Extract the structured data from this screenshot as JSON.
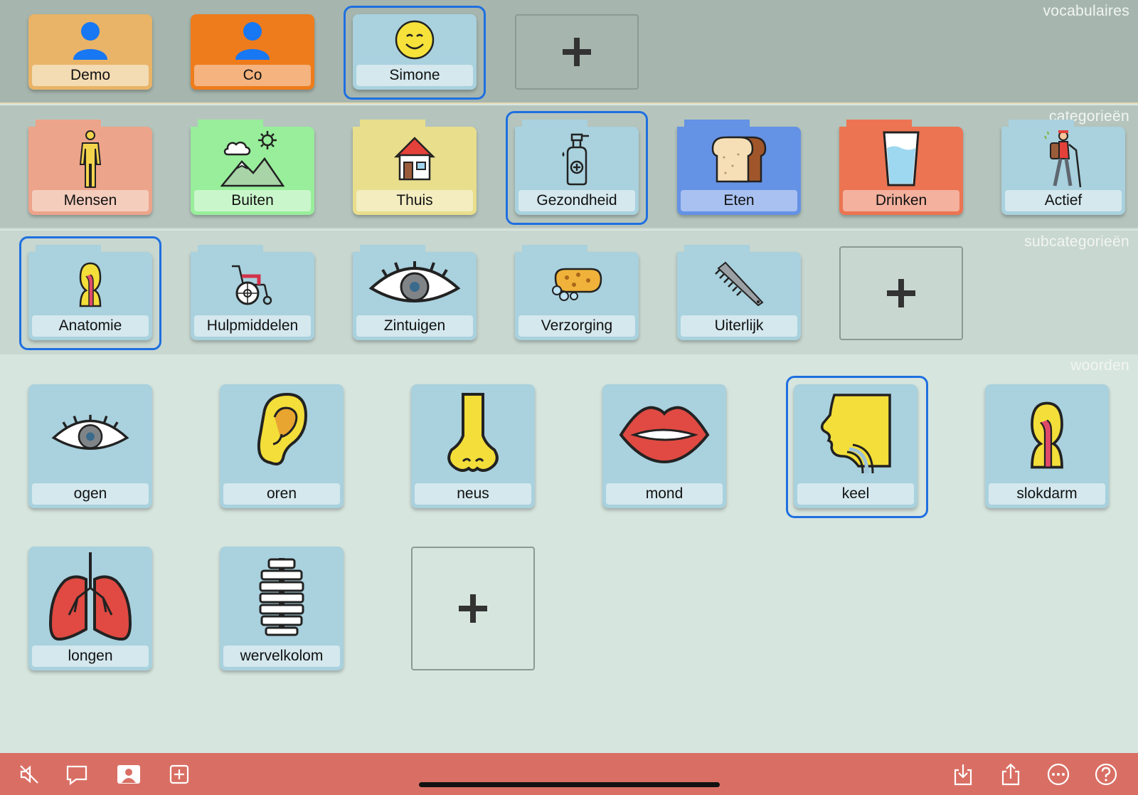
{
  "sections": {
    "vocabularies": "vocabulaires",
    "categories": "categorieën",
    "subcategories": "subcategorieën",
    "words": "woorden"
  },
  "vocabularies": [
    {
      "label": "Demo",
      "icon": "person-icon",
      "color": "#e9b467"
    },
    {
      "label": "Co",
      "icon": "person-icon",
      "color": "#ee7c1c"
    },
    {
      "label": "Simone",
      "icon": "smiley-icon",
      "color": "#a9d1de",
      "selected": true
    }
  ],
  "categories": [
    {
      "label": "Mensen",
      "icon": "person-outline-icon",
      "color": "#eca48a"
    },
    {
      "label": "Buiten",
      "icon": "mountains-icon",
      "color": "#98ee9b"
    },
    {
      "label": "Thuis",
      "icon": "house-icon",
      "color": "#e8de8c"
    },
    {
      "label": "Gezondheid",
      "icon": "sanitizer-bottle-icon",
      "color": "#a9d1de",
      "selected": true
    },
    {
      "label": "Eten",
      "icon": "bread-icon",
      "color": "#6492e5"
    },
    {
      "label": "Drinken",
      "icon": "glass-of-water-icon",
      "color": "#ec7452"
    },
    {
      "label": "Actief",
      "icon": "hiker-icon",
      "color": "#a9d1de"
    }
  ],
  "subcategories": [
    {
      "label": "Anatomie",
      "icon": "anatomy-icon",
      "color": "#a9d1de",
      "selected": true
    },
    {
      "label": "Hulpmiddelen",
      "icon": "wheelchair-icon",
      "color": "#a9d1de"
    },
    {
      "label": "Zintuigen",
      "icon": "eye-icon",
      "color": "#a9d1de"
    },
    {
      "label": "Verzorging",
      "icon": "sponge-icon",
      "color": "#a9d1de"
    },
    {
      "label": "Uiterlijk",
      "icon": "comb-icon",
      "color": "#a9d1de"
    }
  ],
  "words": [
    {
      "label": "ogen",
      "icon": "eye-icon"
    },
    {
      "label": "oren",
      "icon": "ear-icon"
    },
    {
      "label": "neus",
      "icon": "nose-icon"
    },
    {
      "label": "mond",
      "icon": "mouth-icon"
    },
    {
      "label": "keel",
      "icon": "throat-icon",
      "selected": true
    },
    {
      "label": "slokdarm",
      "icon": "esophagus-icon"
    },
    {
      "label": "longen",
      "icon": "lungs-icon"
    },
    {
      "label": "wervelkolom",
      "icon": "spine-icon"
    }
  ],
  "toolbar": {
    "left": [
      "mute-icon",
      "speech-bubble-icon",
      "profile-icon",
      "add-square-icon"
    ],
    "right": [
      "import-icon",
      "share-icon",
      "more-icon",
      "help-icon"
    ]
  },
  "colors": {
    "selection": "#1f6fe0",
    "toolbar": "#d96f64",
    "tile": "#a9d1de"
  }
}
